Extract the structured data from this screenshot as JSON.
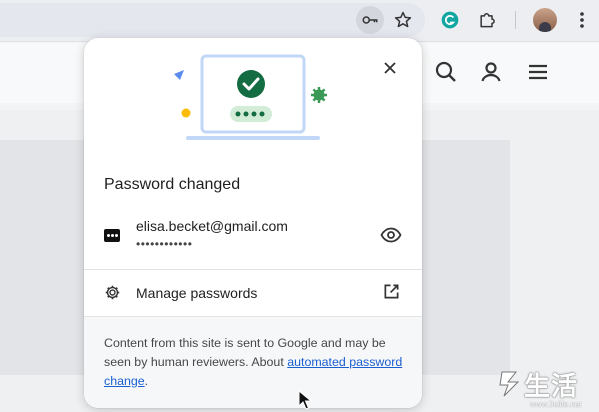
{
  "toolbar": {
    "icons": [
      "key-icon",
      "star-icon",
      "extension-g-icon",
      "puzzle-icon",
      "avatar",
      "more-vert-icon"
    ]
  },
  "page": {
    "icons": [
      "search-icon",
      "account-icon",
      "menu-icon"
    ]
  },
  "popup": {
    "title": "Password changed",
    "account": {
      "username": "elisa.becket@gmail.com",
      "password_mask": "••••••••••••"
    },
    "manage_label": "Manage passwords",
    "footer": {
      "text": "Content from this site is sent to Google and may be seen by human reviewers. About ",
      "link_text": "automated password change",
      "suffix": "."
    }
  },
  "watermark": {
    "text": "生活",
    "url": "www.3elife.net"
  },
  "colors": {
    "accent_green": "#146c43",
    "link_blue": "#1a5fd0",
    "illustration_blue": "#c2d7f8",
    "footer_bg": "#f6f7f8"
  }
}
